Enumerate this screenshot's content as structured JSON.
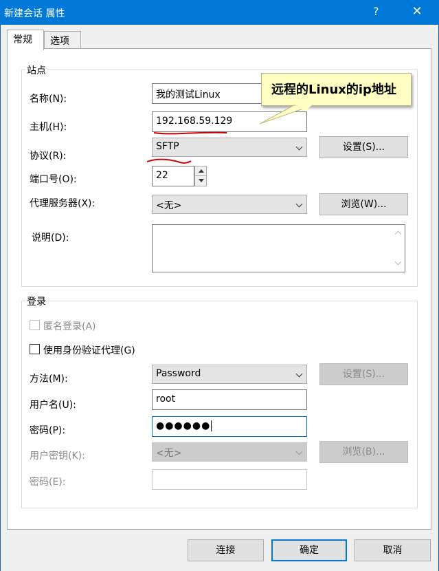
{
  "window": {
    "title": "新建会话 属性",
    "help": "?",
    "close": "✕"
  },
  "tabs": [
    {
      "label": "常规",
      "active": true
    },
    {
      "label": "选项",
      "active": false
    }
  ],
  "site": {
    "group_label": "站点",
    "name_label": "名称(N):",
    "name_value": "我的测试Linux",
    "host_label": "主机(H):",
    "host_value": "192.168.59.129",
    "protocol_label": "协议(R):",
    "protocol_value": "SFTP",
    "protocol_settings_button": "设置(S)...",
    "port_label": "端口号(O):",
    "port_value": "22",
    "proxy_label": "代理服务器(X):",
    "proxy_value": "<无>",
    "proxy_browse_button": "浏览(W)...",
    "description_label": "说明(D):",
    "description_value": ""
  },
  "login": {
    "group_label": "登录",
    "anonymous_label": "匿名登录(A)",
    "anonymous_checked": false,
    "anonymous_enabled": false,
    "auth_agent_label": "使用身份验证代理(G)",
    "auth_agent_checked": false,
    "method_label": "方法(M):",
    "method_value": "Password",
    "method_settings_button": "设置(S)...",
    "username_label": "用户名(U):",
    "username_value": "root",
    "password_label": "密码(P):",
    "password_value": "●●●●●●",
    "user_key_label": "用户密钥(K):",
    "user_key_value": "<无>",
    "user_key_browse_button": "浏览(B)...",
    "passphrase_label": "密码(E):",
    "passphrase_value": ""
  },
  "footer": {
    "connect_button": "连接",
    "ok_button": "确定",
    "cancel_button": "取消"
  },
  "annotation": {
    "callout_text": "远程的Linux的ip地址",
    "callout_bg": "#ffffc4",
    "underline_color": "#cc0000"
  },
  "colors": {
    "title_bar": "#0078d7",
    "dialog_bg": "#f0f0f0",
    "focus_border": "#0078d7"
  }
}
